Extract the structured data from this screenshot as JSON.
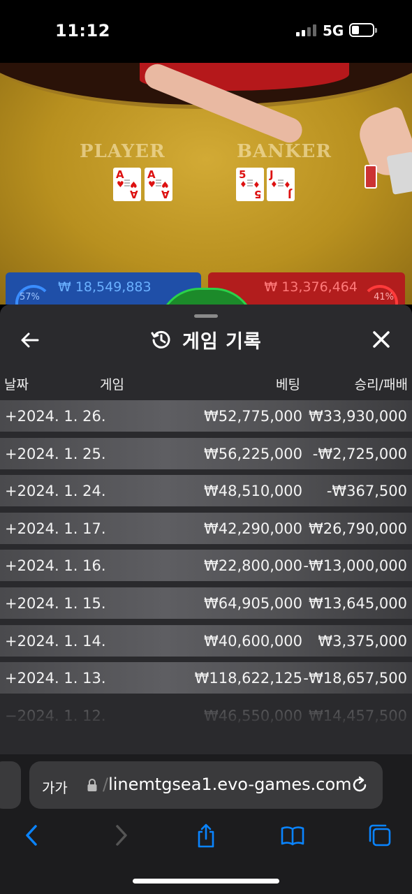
{
  "status_bar": {
    "time": "11:12",
    "network": "5G"
  },
  "table": {
    "player_label": "PLAYER",
    "banker_label": "BANKER",
    "player_cards": [
      {
        "rank": "A",
        "suit": "♥"
      },
      {
        "rank": "A",
        "suit": "♥"
      }
    ],
    "banker_cards": [
      {
        "rank": "5",
        "suit": "♦"
      },
      {
        "rank": "J",
        "suit": "♦"
      }
    ],
    "player_total_bet": "₩ 18,549,883",
    "banker_total_bet": "₩ 13,376,464",
    "player_pct": "57%",
    "banker_pct": "41%"
  },
  "sheet": {
    "title": "게임 기록",
    "headers": {
      "date": "날짜",
      "game": "게임",
      "bet": "베팅",
      "win_loss": "승리/패배"
    },
    "rows": [
      {
        "date": "+2024. 1. 26.",
        "bet": "₩52,775,000",
        "win_loss": "₩33,930,000"
      },
      {
        "date": "+2024. 1. 25.",
        "bet": "₩56,225,000",
        "win_loss": "-₩2,725,000"
      },
      {
        "date": "+2024. 1. 24.",
        "bet": "₩48,510,000",
        "win_loss": "-₩367,500"
      },
      {
        "date": "+2024. 1. 17.",
        "bet": "₩42,290,000",
        "win_loss": "₩26,790,000"
      },
      {
        "date": "+2024. 1. 16.",
        "bet": "₩22,800,000",
        "win_loss": "-₩13,000,000"
      },
      {
        "date": "+2024. 1. 15.",
        "bet": "₩64,905,000",
        "win_loss": "₩13,645,000"
      },
      {
        "date": "+2024. 1. 14.",
        "bet": "₩40,600,000",
        "win_loss": "₩3,375,000"
      },
      {
        "date": "+2024. 1. 13.",
        "bet": "₩118,622,125",
        "win_loss": "-₩18,657,500"
      },
      {
        "date": "−2024. 1. 12.",
        "bet": "₩46,550,000",
        "win_loss": "₩14,457,500"
      }
    ]
  },
  "browser": {
    "text_size_label": "가가",
    "url_slash": "/",
    "url": "linemtgsea1.evo-games.com"
  },
  "colors": {
    "sheet_bg": "#2a2a2d",
    "ios_blue": "#0a84ff",
    "player_blue": "#1f4fa8",
    "banker_red": "#b21d1d"
  }
}
